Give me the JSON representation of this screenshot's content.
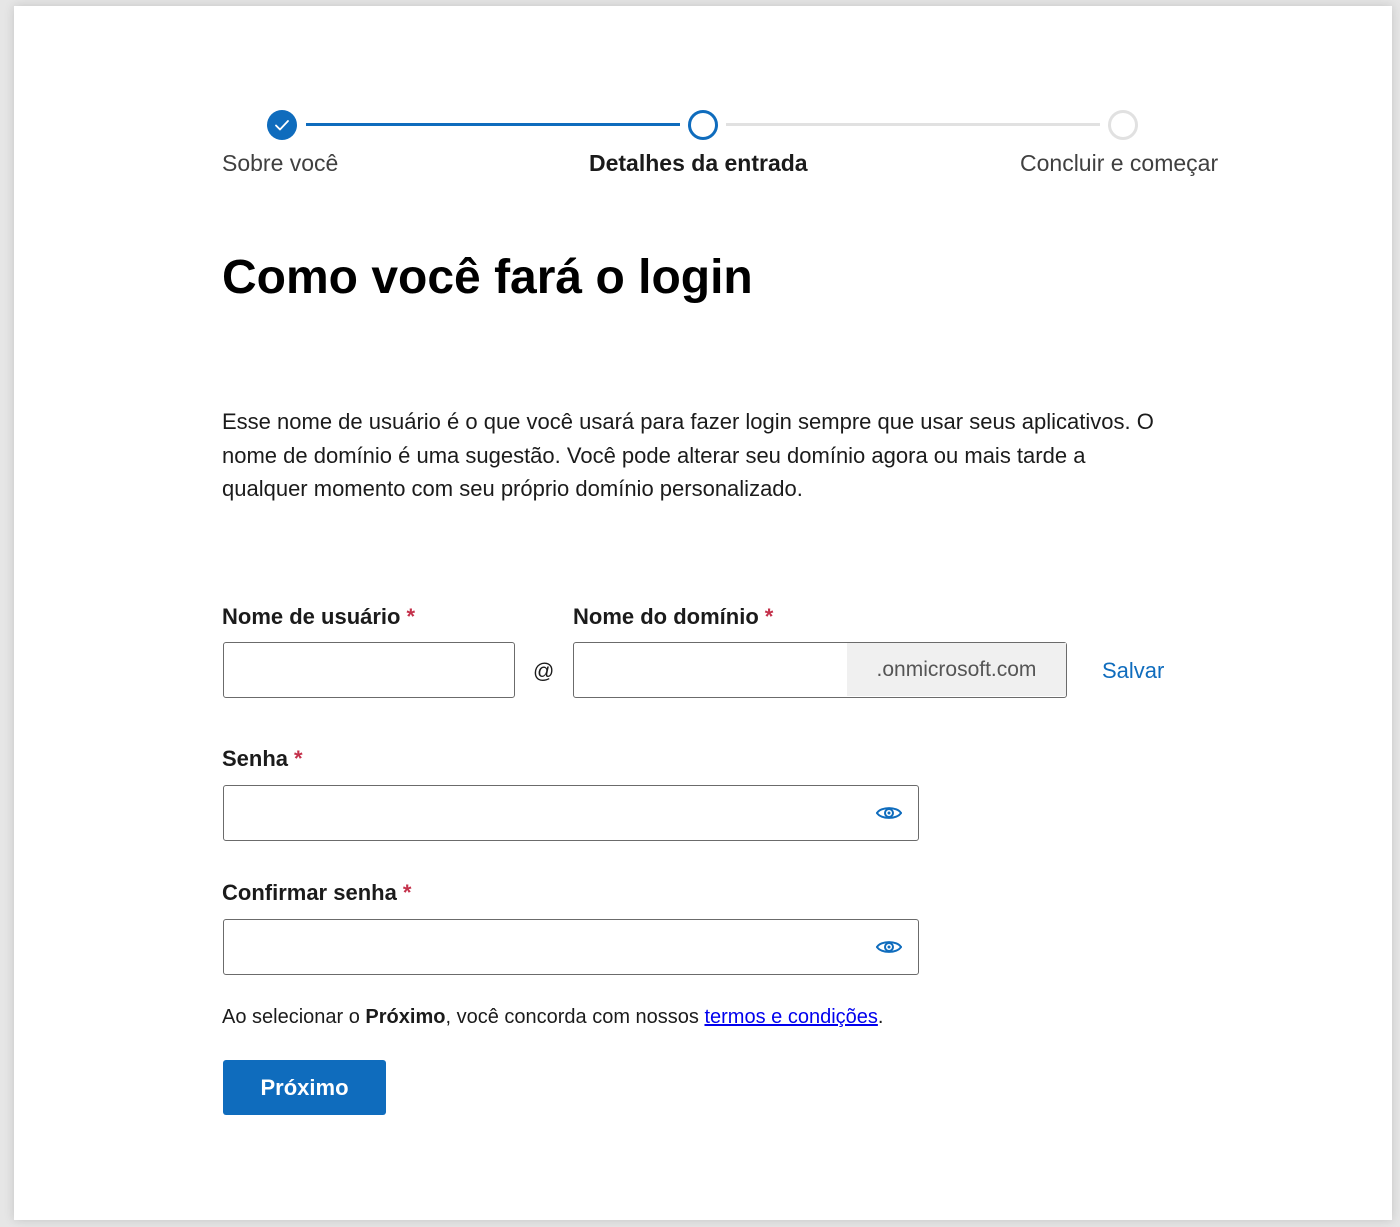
{
  "stepper": {
    "steps": [
      {
        "label": "Sobre você",
        "state": "done"
      },
      {
        "label": "Detalhes da entrada",
        "state": "current"
      },
      {
        "label": "Concluir e começar",
        "state": "todo"
      }
    ]
  },
  "page": {
    "title": "Como você fará o login",
    "description": "Esse nome de usuário é o que você usará para fazer login sempre que usar seus aplicativos. O nome de domínio é uma sugestão. Você pode alterar seu domínio agora ou mais tarde a qualquer momento com seu próprio domínio personalizado."
  },
  "form": {
    "required_marker": "*",
    "username": {
      "label": "Nome de usuário",
      "value": ""
    },
    "at_sign": "@",
    "domain": {
      "label": "Nome do domínio",
      "value": "",
      "suffix": ".onmicrosoft.com"
    },
    "save_label": "Salvar",
    "password": {
      "label": "Senha",
      "value": ""
    },
    "confirm_password": {
      "label": "Confirmar senha",
      "value": ""
    }
  },
  "terms": {
    "prefix": "Ao selecionar o ",
    "bold": "Próximo",
    "middle": ", você concorda com nossos ",
    "link": "termos e condições",
    "suffix": "."
  },
  "next_button": "Próximo",
  "colors": {
    "accent": "#0f6cbd",
    "required": "#c4314b",
    "inactive_step": "#e1e1e1"
  },
  "icons": {
    "done_step": "check-icon",
    "password_toggle": "eye-icon"
  }
}
